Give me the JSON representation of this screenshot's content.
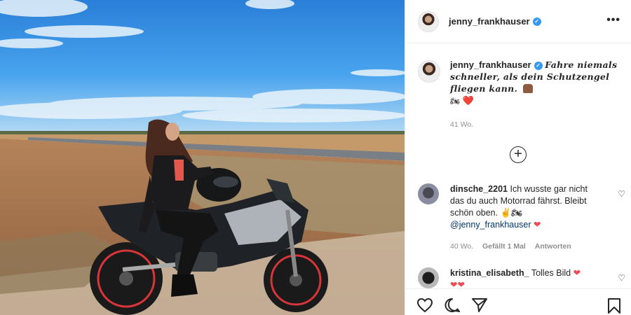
{
  "post": {
    "username": "jenny_frankhauser",
    "caption_text": "Fahre niemals schneller, als dein Schutzengel fliegen kann.",
    "caption_emoji_end": "❤️",
    "timestamp": "41 Wo."
  },
  "comments": [
    {
      "username": "dinsche_2201",
      "text": "Ich wusste gar nicht das du auch Motorrad fährst. Bleibt schön oben. ✌🏍",
      "mention": "@jenny_frankhauser",
      "mention_suffix": "❤",
      "time": "40 Wo.",
      "likes": "Gefällt 1 Mal",
      "reply": "Antworten"
    },
    {
      "username": "kristina_elisabeth_",
      "text": "Tolles Bild",
      "emoji": "❤",
      "emoji_line2": "❤❤"
    }
  ],
  "icons": {
    "verified": "verified-badge-icon",
    "more": "more-options-icon",
    "load_more": "load-more-comments-icon",
    "like": "heart-icon",
    "comment": "comment-icon",
    "share": "share-icon",
    "save": "bookmark-icon"
  },
  "colors": {
    "verified": "#3897f0",
    "heart": "#ed4956",
    "meta": "#8e8e8e",
    "mention": "#00376b"
  }
}
